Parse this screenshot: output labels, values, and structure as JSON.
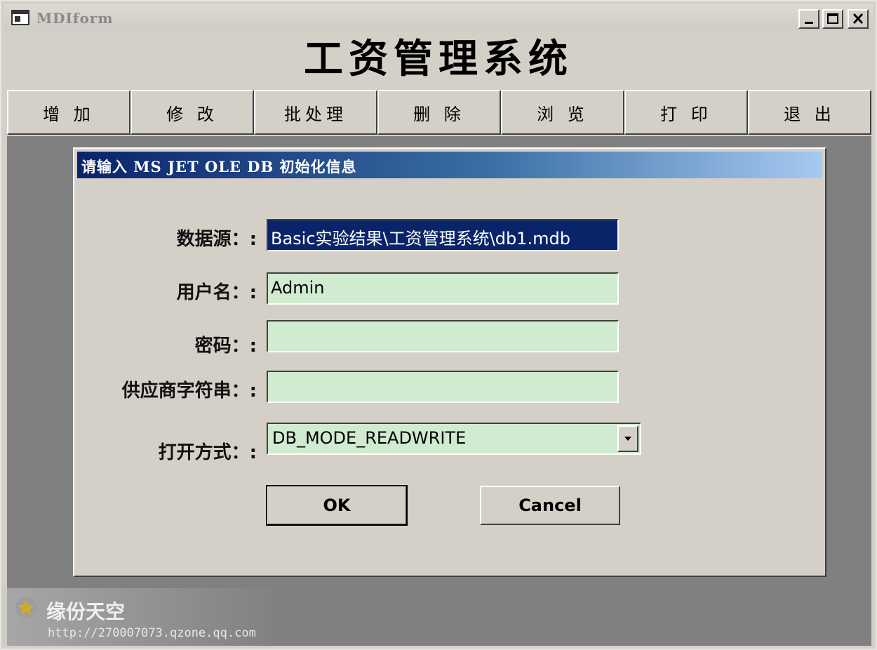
{
  "window": {
    "title": "MDIform",
    "heading": "工资管理系统"
  },
  "toolbar": {
    "items": [
      {
        "label": "增 加"
      },
      {
        "label": "修 改"
      },
      {
        "label": "批处理"
      },
      {
        "label": "删 除"
      },
      {
        "label": "浏 览"
      },
      {
        "label": "打 印"
      },
      {
        "label": "退 出"
      }
    ]
  },
  "dialog": {
    "title": "请输入 MS JET OLE DB 初始化信息",
    "fields": {
      "datasource": {
        "label": "数据源：:",
        "value": "Basic实验结果\\工资管理系统\\db1.mdb"
      },
      "username": {
        "label": "用户名：:",
        "value": "Admin"
      },
      "password": {
        "label": "密码：:",
        "value": ""
      },
      "provider": {
        "label": "供应商字符串：:",
        "value": ""
      },
      "openmode": {
        "label": "打开方式：:",
        "value": "DB_MODE_READWRITE"
      }
    },
    "ok_label": "OK",
    "cancel_label": "Cancel"
  },
  "watermark": {
    "name": "缘份天空",
    "url": "http://270007073.qzone.qq.com"
  },
  "colors": {
    "field_bg": "#d0ebd0",
    "selection_bg": "#0a246a",
    "mdi_bg": "#808080",
    "face": "#d4d0c8"
  }
}
